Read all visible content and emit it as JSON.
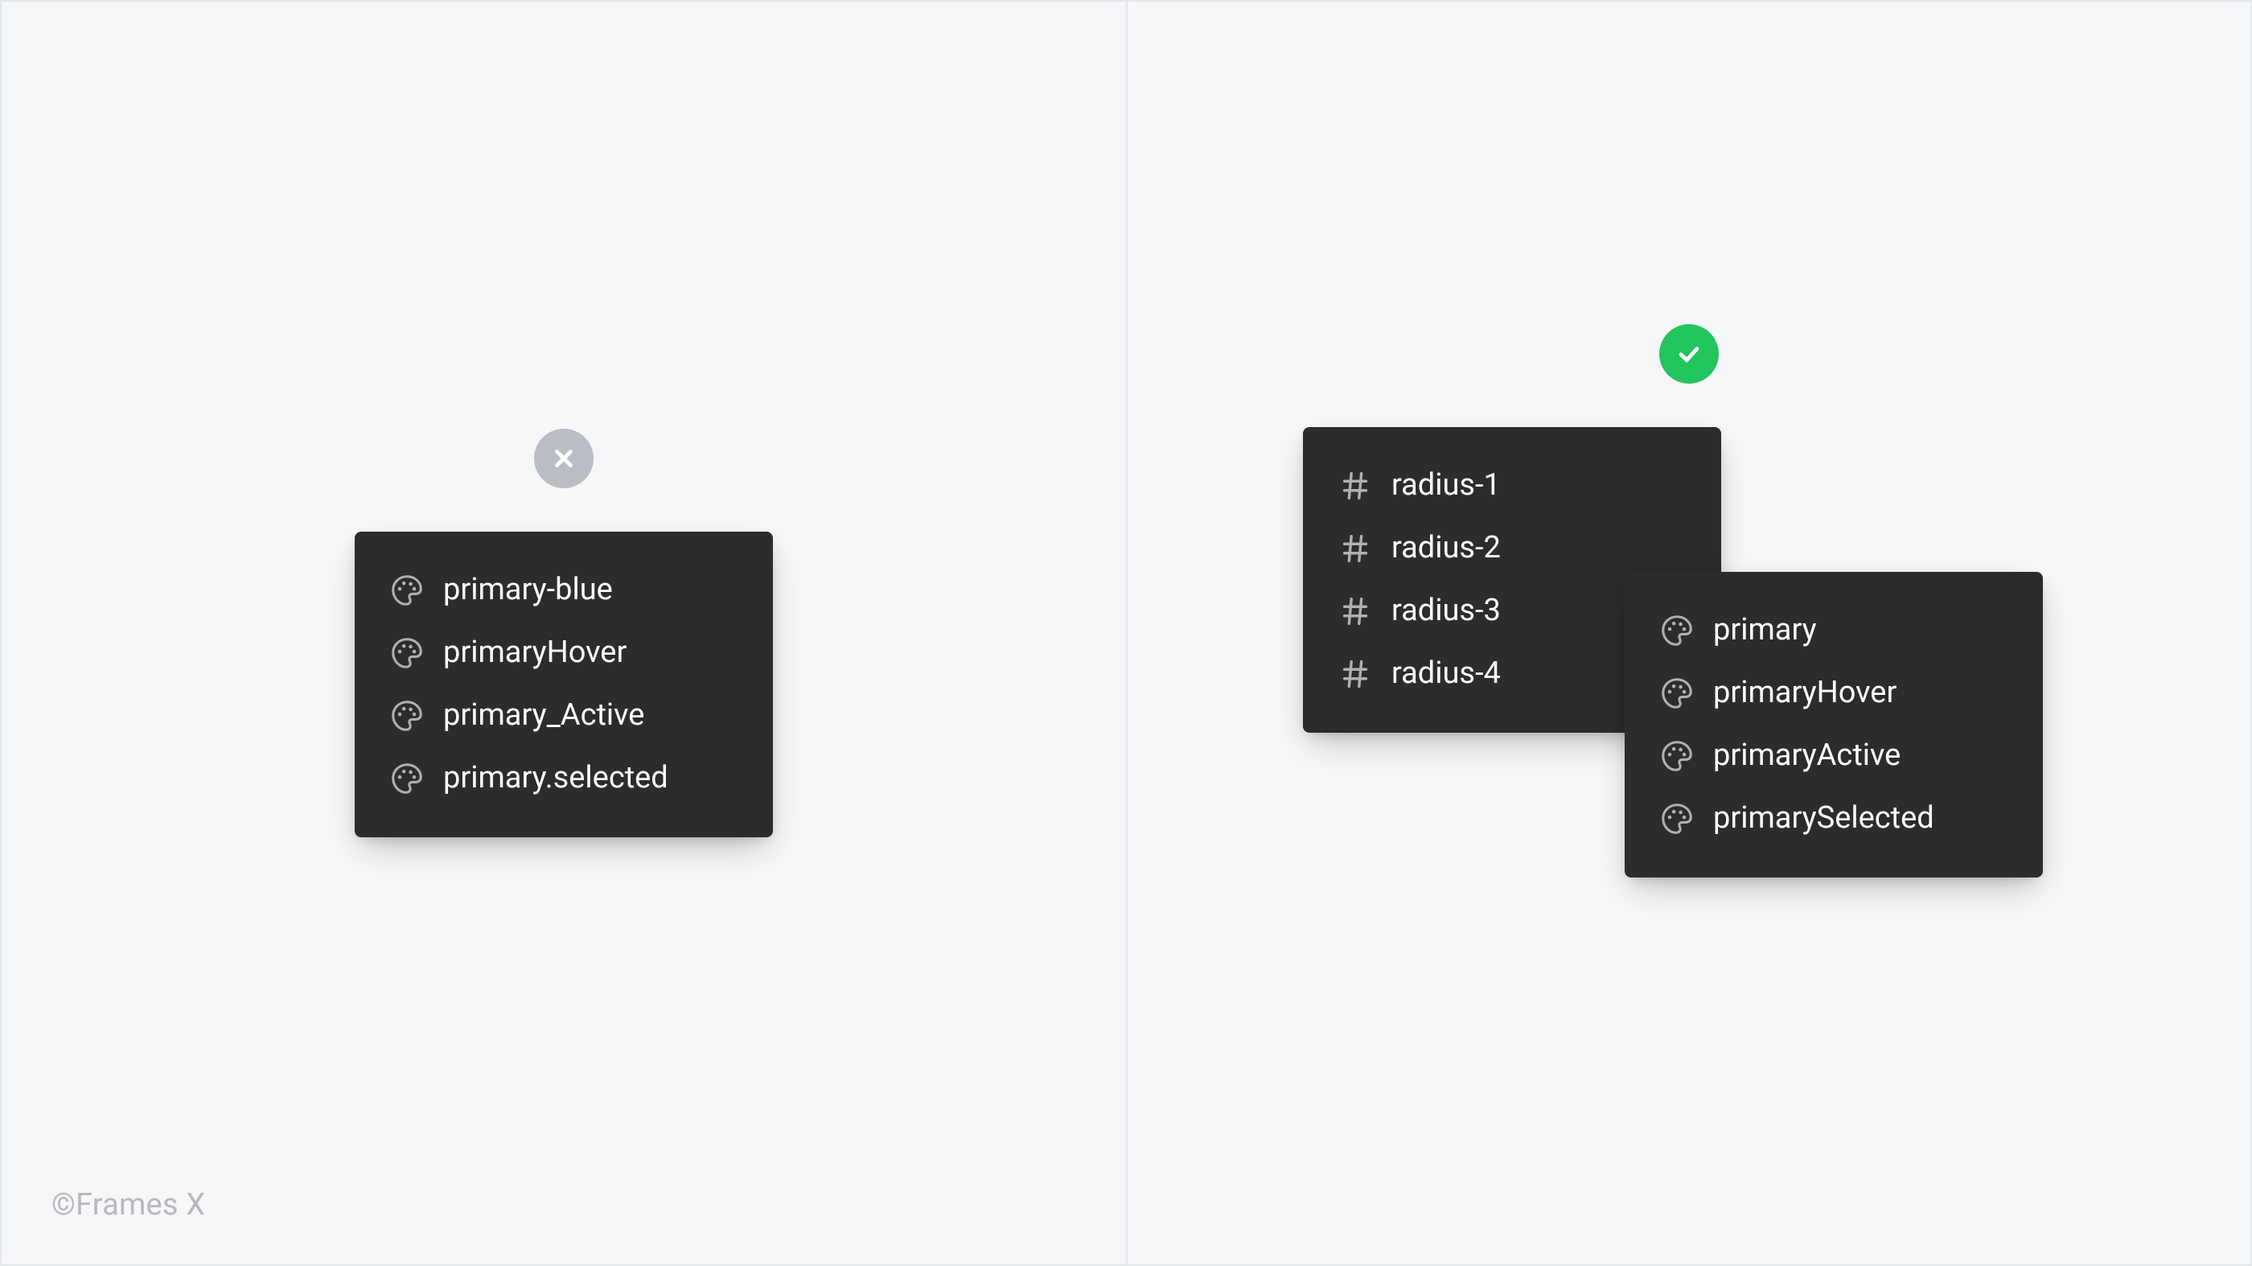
{
  "caption": "©Frames X",
  "status": {
    "wrong_icon": "close-icon",
    "right_icon": "check-icon"
  },
  "left_panel": {
    "items": [
      {
        "icon": "palette-icon",
        "label": "primary-blue"
      },
      {
        "icon": "palette-icon",
        "label": "primaryHover"
      },
      {
        "icon": "palette-icon",
        "label": "primary_Active"
      },
      {
        "icon": "palette-icon",
        "label": "primary.selected"
      }
    ]
  },
  "right_panel_back": {
    "items": [
      {
        "icon": "hash-icon",
        "label": "radius-1"
      },
      {
        "icon": "hash-icon",
        "label": "radius-2"
      },
      {
        "icon": "hash-icon",
        "label": "radius-3"
      },
      {
        "icon": "hash-icon",
        "label": "radius-4"
      }
    ]
  },
  "right_panel_front": {
    "items": [
      {
        "icon": "palette-icon",
        "label": "primary"
      },
      {
        "icon": "palette-icon",
        "label": "primaryHover"
      },
      {
        "icon": "palette-icon",
        "label": "primaryActive"
      },
      {
        "icon": "palette-icon",
        "label": "primarySelected"
      }
    ]
  }
}
